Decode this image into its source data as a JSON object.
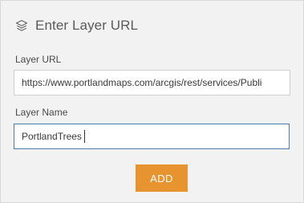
{
  "header": {
    "title": "Enter Layer URL",
    "icon": "layers-icon"
  },
  "form": {
    "url_label": "Layer URL",
    "url_value": "https://www.portlandmaps.com/arcgis/rest/services/Publi",
    "name_label": "Layer Name",
    "name_value": "PortlandTrees"
  },
  "actions": {
    "add_label": "ADD"
  },
  "colors": {
    "accent": "#e7932f",
    "panel_background": "#f2f2f2",
    "focus_border": "#4a7aa8"
  }
}
